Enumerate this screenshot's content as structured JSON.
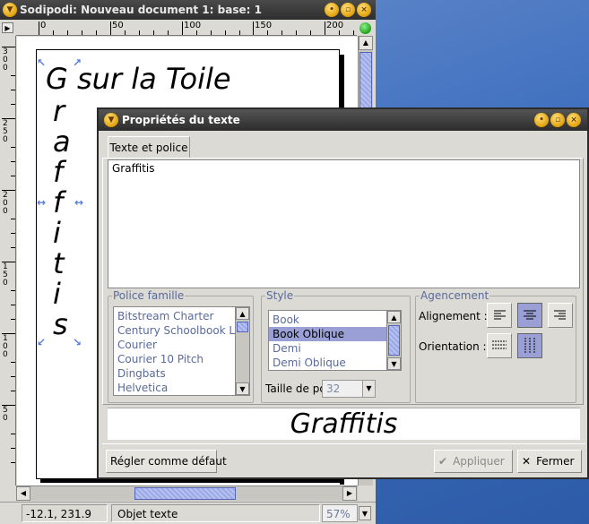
{
  "main_window": {
    "title": "Sodipodi: Nouveau document 1: base: 1",
    "ruler_h_labels": [
      "0",
      "50",
      "100",
      "150",
      "200"
    ],
    "ruler_v_labels": [
      "50",
      "100",
      "150",
      "200",
      "250",
      "300"
    ],
    "canvas": {
      "line1": "G sur la Toile",
      "vertical_letters": [
        "r",
        "a",
        "f",
        "f",
        "i",
        "t",
        "i",
        "s"
      ]
    },
    "status": {
      "coords": "-12.1,  231.9",
      "message": "Objet texte",
      "zoom": "57%"
    }
  },
  "dialog": {
    "title": "Propriétés du texte",
    "tab_label": "Texte et police",
    "text_content": "Graffitis",
    "font_family": {
      "label": "Police famille",
      "items": [
        "Bitstream Charter",
        "Century Schoolbook L",
        "Courier",
        "Courier 10 Pitch",
        "Dingbats",
        "Helvetica"
      ]
    },
    "style": {
      "label": "Style",
      "items": [
        "Book",
        "Book Oblique",
        "Demi",
        "Demi Oblique"
      ],
      "selected_index": 1,
      "size_label": "Taille de police",
      "size_value": "32"
    },
    "layout": {
      "label": "Agencement",
      "alignment_label": "Alignement :",
      "orientation_label": "Orientation :"
    },
    "preview_text": "Graffitis",
    "buttons": {
      "set_default": "Régler comme défaut",
      "apply": "Appliquer",
      "close": "Fermer"
    }
  }
}
